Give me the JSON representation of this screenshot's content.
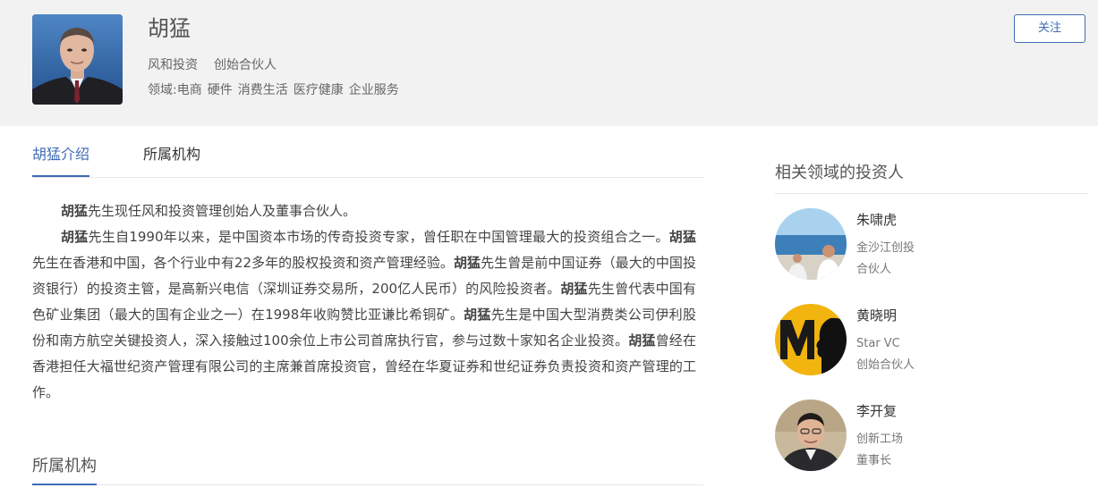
{
  "profile": {
    "name": "胡猛",
    "company": "风和投资",
    "role": "创始合伙人",
    "fields_label": "领域:",
    "fields": [
      "电商",
      "硬件",
      "消费生活",
      "医疗健康",
      "企业服务"
    ],
    "follow_label": "关注"
  },
  "tabs": [
    {
      "label": "胡猛介绍"
    },
    {
      "label": "所属机构"
    }
  ],
  "bio": {
    "name": "胡猛",
    "p1": "先生现任风和投资管理创始人及董事合伙人。",
    "p2_a": "先生自1990年以来，是中国资本市场的传奇投资专家，曾任职在中国管理最大的投资组合之一。",
    "p2_b": "先生在香港和中国，各个行业中有22多年的股权投资和资产管理经验。",
    "p2_c": "先生曾是前中国证券（最大的中国投资银行）的投资主管，是高新兴电信（深圳证券交易所，200亿人民币）的风险投资者。",
    "p2_d": "先生曾代表中国有色矿业集团（最大的国有企业之一）在1998年收购赞比亚谦比希铜矿。",
    "p2_e": "先生是中国大型消费类公司伊利股份和南方航空关键投资人，深入接触过100余位上市公司首席执行官，参与过数十家知名企业投资。",
    "p2_f": "曾经在香港担任大福世纪资产管理有限公司的主席兼首席投资官，曾经在华夏证券和世纪证券负责投资和资产管理的工作。"
  },
  "section": {
    "org_title": "所属机构"
  },
  "sidebar": {
    "title": "相关领域的投资人",
    "investors": [
      {
        "name": "朱啸虎",
        "org": "金沙江创投",
        "role": "合伙人"
      },
      {
        "name": "黄晓明",
        "org": "Star VC",
        "role": "创始合伙人"
      },
      {
        "name": "李开复",
        "org": "创新工场",
        "role": "董事长"
      }
    ]
  },
  "colors": {
    "accent": "#3e6bb5",
    "header_bg": "#f2f2f2"
  }
}
